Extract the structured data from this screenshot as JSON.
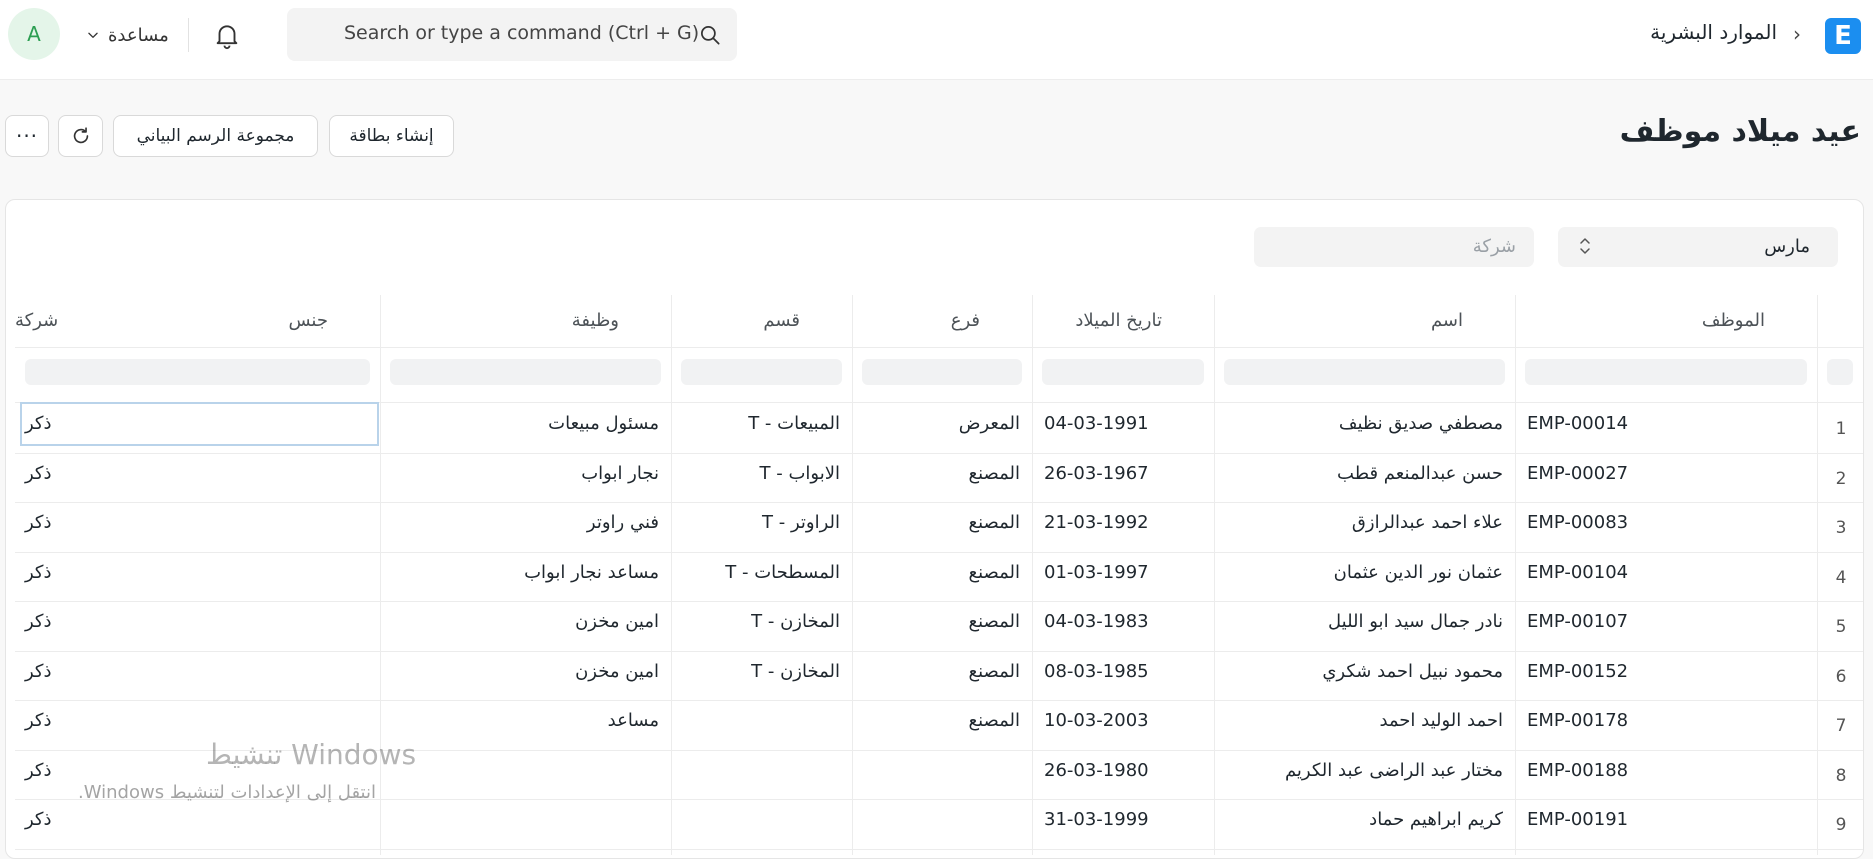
{
  "navbar": {
    "logo_letter": "E",
    "breadcrumb_separator": "›",
    "breadcrumb": "الموارد البشرية",
    "search_placeholder": "Search or type a command (Ctrl + G)",
    "help_label": "مساعدة",
    "avatar_letter": "A"
  },
  "page": {
    "title": "عيد ميلاد موظف",
    "buttons": {
      "create_card": "إنشاء بطاقة",
      "chart_group": "مجموعة الرسم البياني",
      "more": "···"
    }
  },
  "filters": {
    "month_value": "مارس",
    "company_placeholder": "شركة"
  },
  "table": {
    "columns": [
      "الموظف",
      "اسم",
      "تاريخ الميلاد",
      "فرع",
      "قسم",
      "وظيفة",
      "جنس",
      "شركة"
    ],
    "rows": [
      {
        "no": "1",
        "employee": "EMP-00014",
        "name": "مصطفي صديق نظيف",
        "birth_date": "04-03-1991",
        "branch": "المعرض",
        "department": "المبيعات - T",
        "designation": "مسئول مبيعات",
        "gender": "ذكر",
        "company": ""
      },
      {
        "no": "2",
        "employee": "EMP-00027",
        "name": "حسن عبدالمنعم قطب",
        "birth_date": "26-03-1967",
        "branch": "المصنع",
        "department": "الابواب - T",
        "designation": "نجار ابواب",
        "gender": "ذكر",
        "company": ""
      },
      {
        "no": "3",
        "employee": "EMP-00083",
        "name": "علاء احمد عبدالرازق",
        "birth_date": "21-03-1992",
        "branch": "المصنع",
        "department": "الراوتر - T",
        "designation": "فني راوتر",
        "gender": "ذكر",
        "company": ""
      },
      {
        "no": "4",
        "employee": "EMP-00104",
        "name": "عثمان نور الدين عثمان",
        "birth_date": "01-03-1997",
        "branch": "المصنع",
        "department": "المسطحات - T",
        "designation": "مساعد نجار ابواب",
        "gender": "ذكر",
        "company": ""
      },
      {
        "no": "5",
        "employee": "EMP-00107",
        "name": "نادر جمال سيد ابو الليل",
        "birth_date": "04-03-1983",
        "branch": "المصنع",
        "department": "المخازن - T",
        "designation": "امين مخزن",
        "gender": "ذكر",
        "company": ""
      },
      {
        "no": "6",
        "employee": "EMP-00152",
        "name": "محمود نبيل احمد شكري",
        "birth_date": "08-03-1985",
        "branch": "المصنع",
        "department": "المخازن - T",
        "designation": "امين مخزن",
        "gender": "ذكر",
        "company": ""
      },
      {
        "no": "7",
        "employee": "EMP-00178",
        "name": "احمد الوليد احمد",
        "birth_date": "10-03-2003",
        "branch": "المصنع",
        "department": "",
        "designation": "مساعد",
        "gender": "ذكر",
        "company": ""
      },
      {
        "no": "8",
        "employee": "EMP-00188",
        "name": "مختار عبد الراضى عبد الكريم",
        "birth_date": "26-03-1980",
        "branch": "",
        "department": "",
        "designation": "",
        "gender": "ذكر",
        "company": ""
      },
      {
        "no": "9",
        "employee": "EMP-00191",
        "name": "كريم ابراهيم حماد",
        "birth_date": "31-03-1999",
        "branch": "",
        "department": "",
        "designation": "",
        "gender": "ذكر",
        "company": ""
      }
    ]
  },
  "watermark": {
    "title": "تنشيط Windows",
    "subtitle": "انتقل إلى الإعدادات لتنشيط Windows."
  },
  "colors": {
    "logo_bg": "#1b8ef0",
    "avatar_bg": "#e4f5e9",
    "avatar_fg": "#2c9e52",
    "focus_border": "#b9d3ea"
  }
}
